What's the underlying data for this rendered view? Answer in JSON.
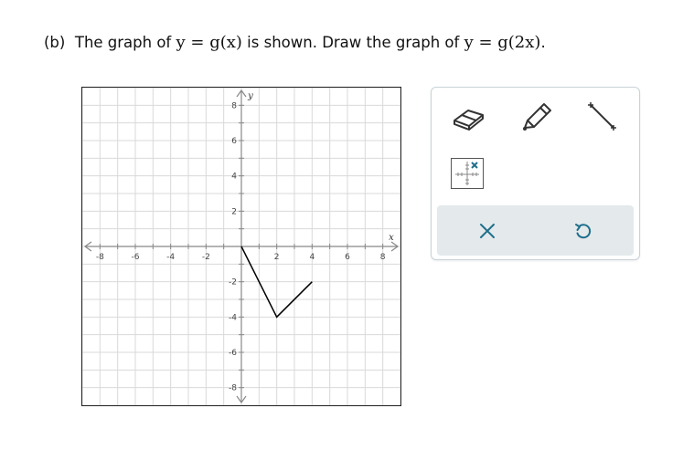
{
  "question": {
    "part": "(b)",
    "text_1": "The graph of",
    "math_1": "y = g(x)",
    "text_2": "is shown. Draw the graph of",
    "math_2": "y = g(2x)",
    "end": "."
  },
  "graph": {
    "x_axis_var": "x",
    "y_axis_var": "y",
    "x_tick_labels": [
      "-8",
      "-6",
      "-4",
      "-2",
      "2",
      "4",
      "6",
      "8"
    ],
    "y_tick_labels": [
      "8",
      "6",
      "4",
      "2",
      "-2",
      "-4",
      "-6",
      "-8"
    ],
    "grid": true,
    "xlim": [
      -9,
      9
    ],
    "ylim": [
      -9,
      9
    ],
    "function_points": [
      [
        0,
        0
      ],
      [
        2,
        -4
      ],
      [
        4,
        -2
      ]
    ],
    "line_color": "#000000",
    "grid_color": "#d9d9d9",
    "axis_color": "#888888"
  },
  "toolbox": {
    "tools": [
      "eraser-icon",
      "pencil-icon",
      "line-segment-icon",
      "point-grid-icon"
    ],
    "actions": [
      "clear-icon",
      "undo-icon"
    ],
    "accent_color": "#1f6f8b",
    "action_bar_color": "#e4e9ec"
  }
}
